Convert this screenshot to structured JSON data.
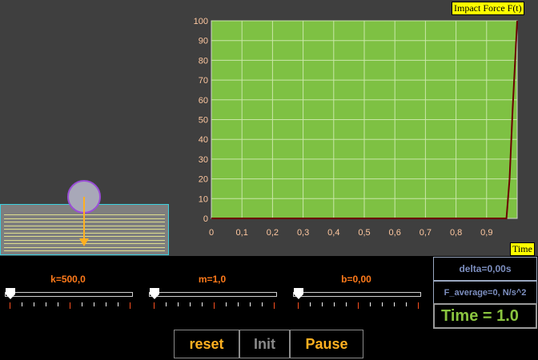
{
  "graph": {
    "title": "Impact Force F(t)",
    "xlabel": "Time",
    "plot_bg": "#7ec143",
    "grid_color": "#c9e7a8",
    "curve_color": "#6b0000",
    "tick_color": "#ffc8a0"
  },
  "chart_data": {
    "type": "line",
    "title": "Impact Force F(t)",
    "xlabel": "Time",
    "ylabel": "",
    "xlim": [
      0,
      1.0
    ],
    "ylim": [
      0,
      100
    ],
    "x_ticks": [
      "0",
      "0,1",
      "0,2",
      "0,3",
      "0,4",
      "0,5",
      "0,6",
      "0,7",
      "0,8",
      "0,9"
    ],
    "y_ticks": [
      "0",
      "10",
      "20",
      "30",
      "40",
      "50",
      "60",
      "70",
      "80",
      "90",
      "100"
    ],
    "grid": true,
    "series": [
      {
        "x": [
          0.0,
          0.965,
          0.975,
          0.985,
          1.0
        ],
        "y": [
          0,
          0,
          20,
          55,
          110
        ]
      }
    ]
  },
  "sliders": [
    {
      "label": "k=500,0",
      "value": 0
    },
    {
      "label": "m=1,0",
      "value": 0
    },
    {
      "label": "b=0,00",
      "value": 0
    }
  ],
  "info": {
    "delta": "delta=0,00s",
    "f_average": "F_average=0, N/s^2",
    "time": "Time = 1.0"
  },
  "buttons": {
    "reset": "reset",
    "init": "Init",
    "pause": "Pause"
  },
  "colors": {
    "accent": "#ffb020",
    "slider_label": "#ff7a1a",
    "time_text": "#8ac43f"
  }
}
